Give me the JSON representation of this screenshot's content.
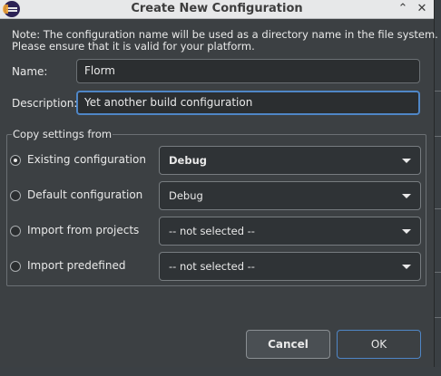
{
  "window": {
    "title": "Create New Configuration"
  },
  "note": {
    "line1": "Note: The configuration name will be used as a directory name in the file system.",
    "line2": "Please ensure that it is valid for your platform."
  },
  "form": {
    "name_label": "Name:",
    "name_value": "Florm",
    "description_label": "Description:",
    "description_value": "Yet another build configuration"
  },
  "copy_settings": {
    "title": "Copy settings from",
    "options": [
      {
        "label": "Existing configuration",
        "selected": true,
        "combo_value": "Debug"
      },
      {
        "label": "Default configuration",
        "selected": false,
        "combo_value": "Debug"
      },
      {
        "label": "Import from projects",
        "selected": false,
        "combo_value": "-- not selected --"
      },
      {
        "label": "Import predefined",
        "selected": false,
        "combo_value": "-- not selected --"
      }
    ]
  },
  "buttons": {
    "cancel": "Cancel",
    "ok": "OK"
  },
  "icons": {
    "app": "eclipse-logo-icon",
    "maximize": "chevron-up-icon",
    "close": "close-icon",
    "combo_arrow": "chevron-down-icon"
  },
  "colors": {
    "dialog_background": "#3c4043",
    "focus_accent": "#4f86c6",
    "titlebar": "#e7e8e9"
  }
}
